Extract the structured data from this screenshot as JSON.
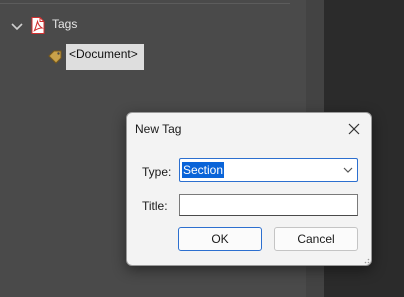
{
  "tree": {
    "root_label": "Tags",
    "child_label": "<Document>",
    "icons": {
      "expand": "chevron-down-icon",
      "root": "pdf-file-icon",
      "child": "tag-icon"
    }
  },
  "dialog": {
    "title": "New Tag",
    "close_icon": "close-icon",
    "type_label": "Type:",
    "type_value": "Section",
    "title_label": "Title:",
    "title_value": "",
    "ok_label": "OK",
    "cancel_label": "Cancel"
  },
  "colors": {
    "selection": "#0a64d8",
    "focus_border": "#2c6fcf",
    "pdf_red": "#d32f2f"
  }
}
